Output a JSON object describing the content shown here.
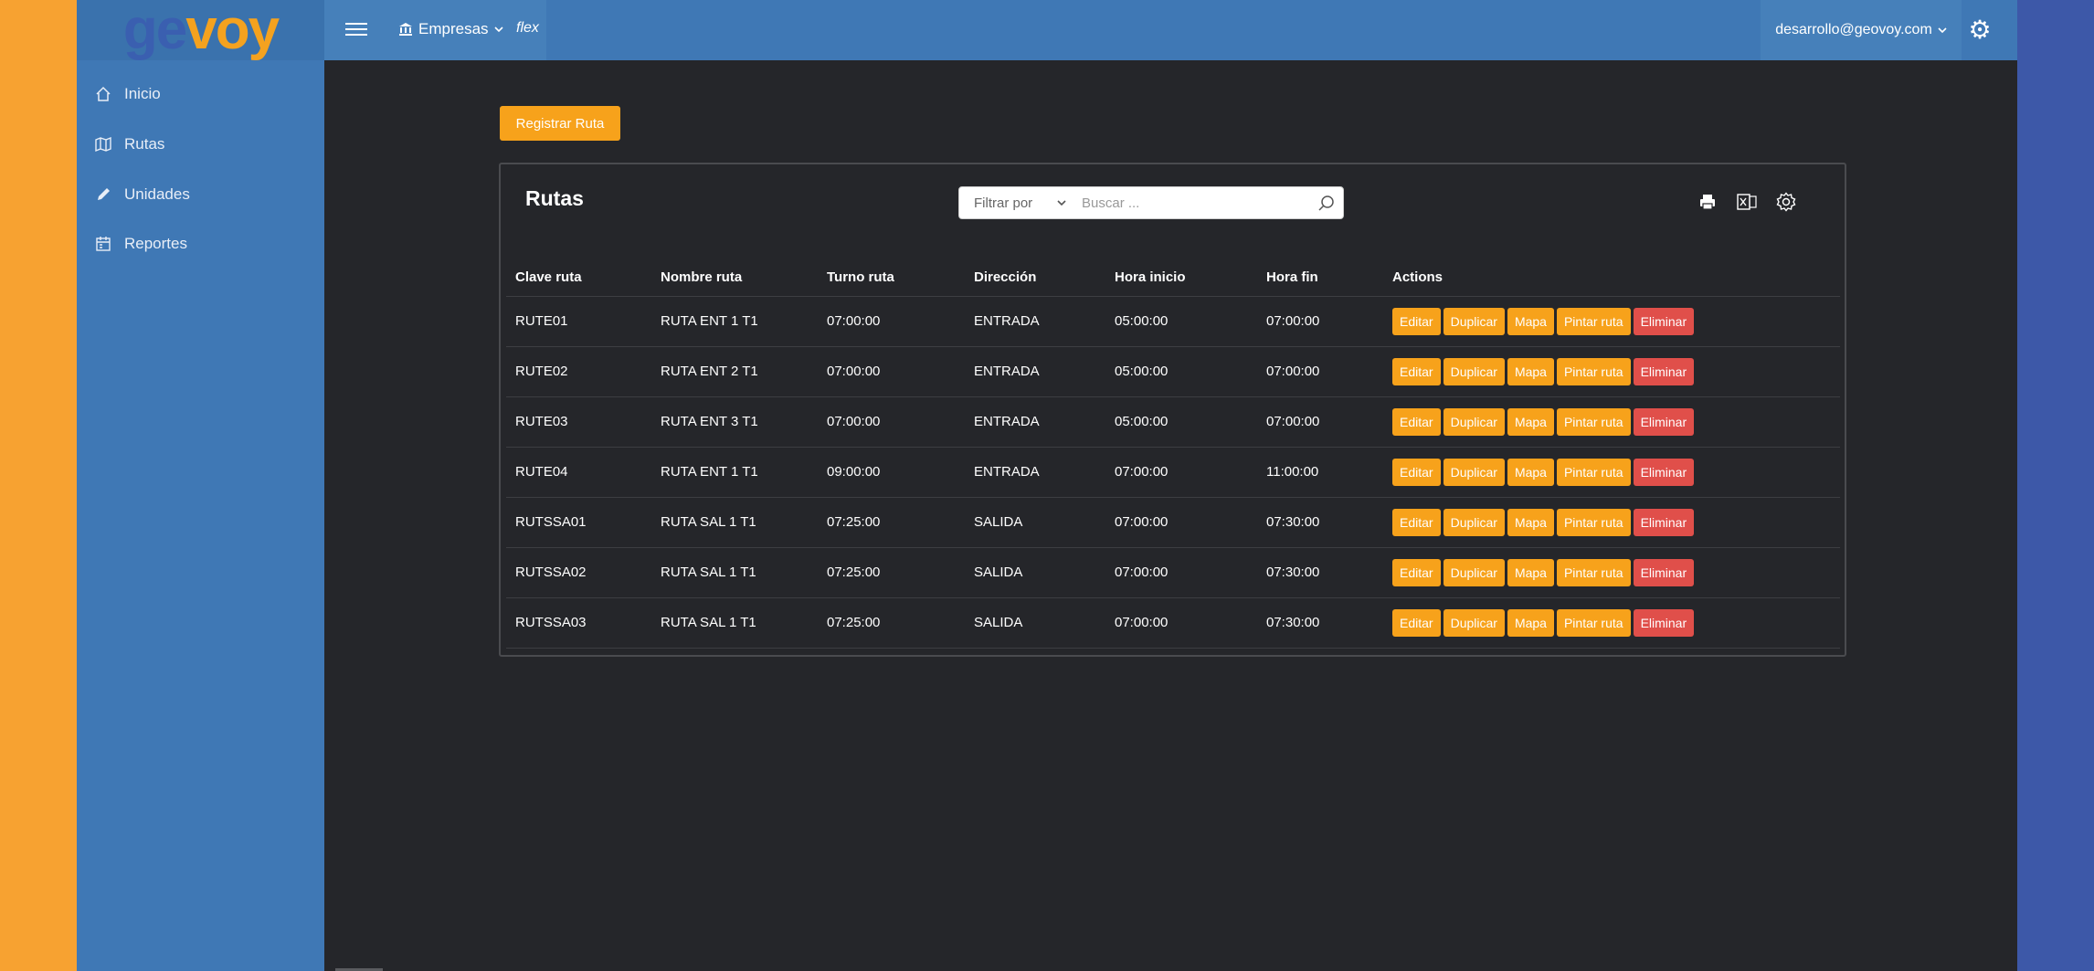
{
  "brand": {
    "logo_a": "ge",
    "logo_b": "voy"
  },
  "header": {
    "empresas_label": "Empresas",
    "flex_label": "flex",
    "user_email": "desarrollo@geovoy.com"
  },
  "sidebar": {
    "items": [
      {
        "label": "Inicio",
        "icon": "home-icon"
      },
      {
        "label": "Rutas",
        "icon": "map-icon"
      },
      {
        "label": "Unidades",
        "icon": "pencil-icon"
      },
      {
        "label": "Reportes",
        "icon": "calendar-icon"
      }
    ]
  },
  "main": {
    "register_button": "Registrar Ruta",
    "panel_title": "Rutas",
    "filter_label": "Filtrar por",
    "search_placeholder": "Buscar ...",
    "columns": [
      "Clave ruta",
      "Nombre ruta",
      "Turno ruta",
      "Dirección",
      "Hora inicio",
      "Hora fin",
      "Actions"
    ],
    "actions": {
      "edit": "Editar",
      "duplicate": "Duplicar",
      "map": "Mapa",
      "paint": "Pintar ruta",
      "delete": "Eliminar"
    },
    "rows": [
      [
        "RUTE01",
        "RUTA ENT 1 T1",
        "07:00:00",
        "ENTRADA",
        "05:00:00",
        "07:00:00"
      ],
      [
        "RUTE02",
        "RUTA ENT 2 T1",
        "07:00:00",
        "ENTRADA",
        "05:00:00",
        "07:00:00"
      ],
      [
        "RUTE03",
        "RUTA ENT 3 T1",
        "07:00:00",
        "ENTRADA",
        "05:00:00",
        "07:00:00"
      ],
      [
        "RUTE04",
        "RUTA ENT 1 T1",
        "09:00:00",
        "ENTRADA",
        "07:00:00",
        "11:00:00"
      ],
      [
        "RUTSSA01",
        "RUTA SAL 1 T1",
        "07:25:00",
        "SALIDA",
        "07:00:00",
        "07:30:00"
      ],
      [
        "RUTSSA02",
        "RUTA SAL 1 T1",
        "07:25:00",
        "SALIDA",
        "07:00:00",
        "07:30:00"
      ],
      [
        "RUTSSA03",
        "RUTA SAL 1 T1",
        "07:25:00",
        "SALIDA",
        "07:00:00",
        "07:30:00"
      ]
    ]
  },
  "colors": {
    "accent": "#f7a21b",
    "danger": "#e04f4a",
    "header": "#3f78b5",
    "content_bg": "#25262a"
  }
}
